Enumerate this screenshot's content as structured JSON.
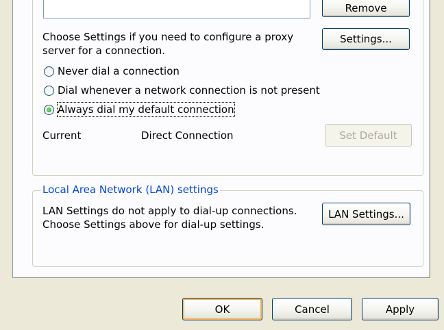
{
  "proxy": {
    "remove_label": "Remove",
    "description": [
      "Choose Settings if you need to configure a proxy",
      "server for a connection."
    ],
    "settings_label": "Settings..."
  },
  "dial_options": [
    {
      "label": "Never dial a connection",
      "selected": false
    },
    {
      "label": "Dial whenever a network connection is not present",
      "selected": false
    },
    {
      "label": "Always dial my default connection",
      "selected": true
    }
  ],
  "current": {
    "label": "Current",
    "value": "Direct Connection",
    "set_default_label": "Set Default"
  },
  "lan": {
    "legend": "Local Area Network (LAN) settings",
    "description": [
      "LAN Settings do not apply to dial-up connections.",
      "Choose Settings above for dial-up settings."
    ],
    "button_label": "LAN Settings..."
  },
  "footer": {
    "ok_label": "OK",
    "cancel_label": "Cancel",
    "apply_label": "Apply"
  },
  "colors": {
    "window_bg": "#ece9d8",
    "panel_bg": "#fcfcfe",
    "legend_text": "#0046d5",
    "button_border": "#003c74",
    "default_button_highlight": "#f8b34a"
  }
}
